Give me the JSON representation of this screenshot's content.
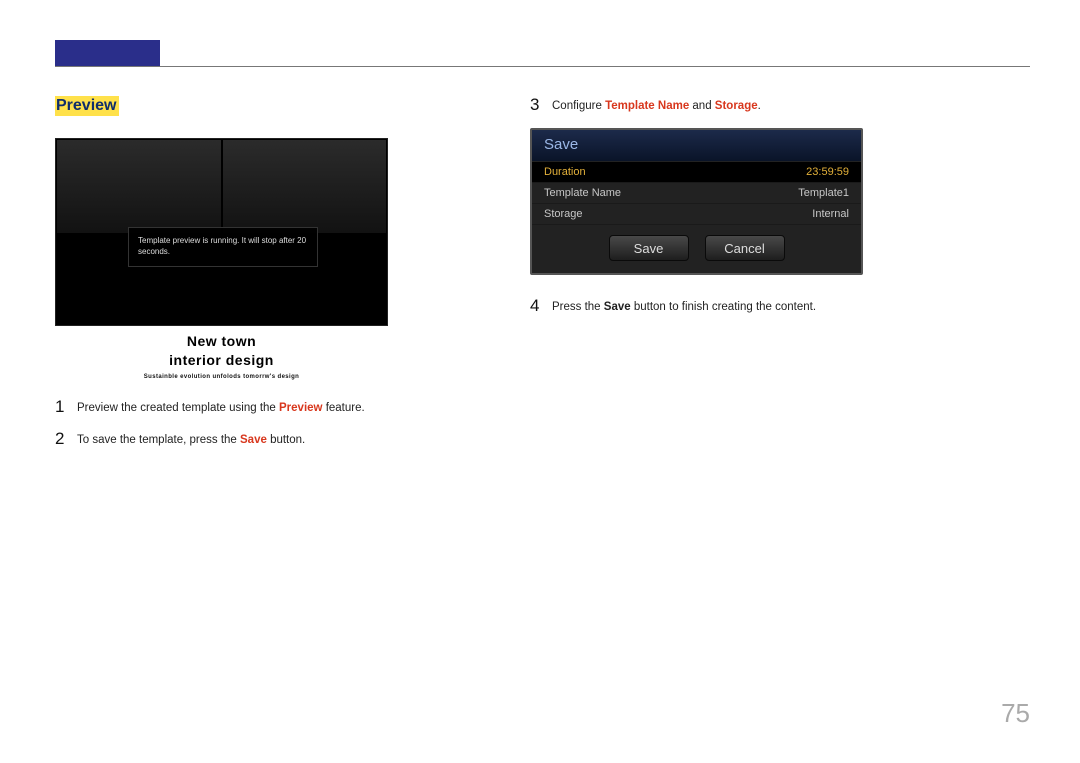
{
  "section_title": "Preview",
  "preview": {
    "message": "Template preview is running. It will stop after 20 seconds.",
    "caption_line1": "New town",
    "caption_line2": "interior design",
    "caption_sub": "Sustainble evolution unfolods tomorrw's design"
  },
  "steps_left": [
    {
      "num": "1",
      "parts": [
        {
          "t": "Preview the created template using the "
        },
        {
          "t": "Preview",
          "cls": "kw-red"
        },
        {
          "t": " feature."
        }
      ]
    },
    {
      "num": "2",
      "parts": [
        {
          "t": "To save the template, press the "
        },
        {
          "t": "Save",
          "cls": "kw-red"
        },
        {
          "t": " button."
        }
      ]
    }
  ],
  "steps_right": [
    {
      "num": "3",
      "parts": [
        {
          "t": "Configure "
        },
        {
          "t": "Template Name",
          "cls": "kw-red"
        },
        {
          "t": " and "
        },
        {
          "t": "Storage",
          "cls": "kw-red"
        },
        {
          "t": "."
        }
      ]
    },
    {
      "num": "4",
      "parts": [
        {
          "t": "Press the "
        },
        {
          "t": "Save",
          "cls": "kw-bold"
        },
        {
          "t": " button to finish creating the content."
        }
      ]
    }
  ],
  "dialog": {
    "title": "Save",
    "rows": [
      {
        "label": "Duration",
        "value": "23:59:59",
        "selected": true
      },
      {
        "label": "Template Name",
        "value": "Template1",
        "selected": false
      },
      {
        "label": "Storage",
        "value": "Internal",
        "selected": false
      }
    ],
    "save_btn": "Save",
    "cancel_btn": "Cancel"
  },
  "page_number": "75"
}
